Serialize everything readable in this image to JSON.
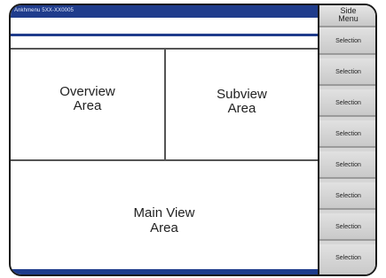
{
  "header": {
    "title": "Ankhmenu 5XX-XX0005"
  },
  "areas": {
    "overview": {
      "line1": "Overview",
      "line2": "Area"
    },
    "subview": {
      "line1": "Subview",
      "line2": "Area"
    },
    "main": {
      "line1": "Main View",
      "line2": "Area"
    }
  },
  "side_menu": {
    "title_line1": "Side",
    "title_line2": "Menu",
    "items": [
      {
        "label": "Selection"
      },
      {
        "label": "Selection"
      },
      {
        "label": "Selection"
      },
      {
        "label": "Selection"
      },
      {
        "label": "Selection"
      },
      {
        "label": "Selection"
      },
      {
        "label": "Selection"
      },
      {
        "label": "Selection"
      }
    ]
  },
  "colors": {
    "header": "#1f3c8c",
    "sidebar": "#d6d6d6"
  }
}
